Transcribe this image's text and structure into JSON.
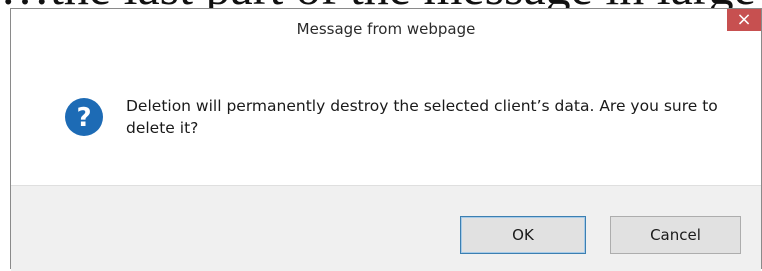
{
  "background_text": "…the last part of the message in large serif font",
  "dialog": {
    "title": "Message from webpage",
    "close_glyph": "×",
    "icon": "question-icon",
    "message": "Deletion will permanently destroy the selected client’s data. Are you sure to delete it?",
    "buttons": {
      "ok_label": "OK",
      "cancel_label": "Cancel"
    }
  },
  "colors": {
    "close_button": "#c75050",
    "question_icon": "#1d6bb5",
    "footer_background": "#f0f0f0",
    "default_button_border": "#3c7fb1"
  }
}
